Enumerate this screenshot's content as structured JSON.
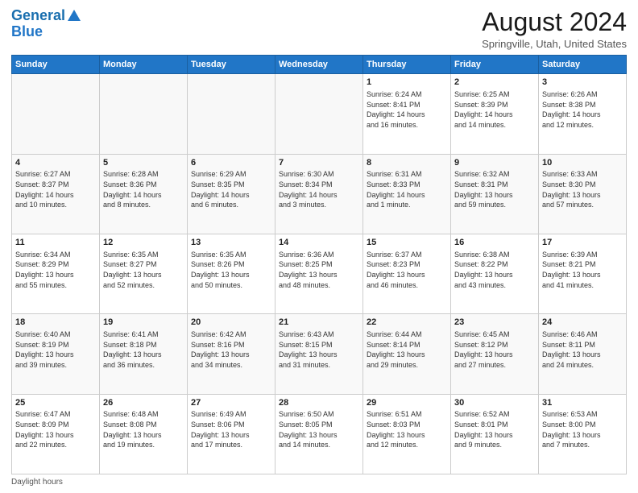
{
  "header": {
    "logo_line1": "General",
    "logo_line2": "Blue",
    "month_title": "August 2024",
    "location": "Springville, Utah, United States"
  },
  "days_of_week": [
    "Sunday",
    "Monday",
    "Tuesday",
    "Wednesday",
    "Thursday",
    "Friday",
    "Saturday"
  ],
  "weeks": [
    [
      {
        "day": "",
        "info": ""
      },
      {
        "day": "",
        "info": ""
      },
      {
        "day": "",
        "info": ""
      },
      {
        "day": "",
        "info": ""
      },
      {
        "day": "1",
        "info": "Sunrise: 6:24 AM\nSunset: 8:41 PM\nDaylight: 14 hours\nand 16 minutes."
      },
      {
        "day": "2",
        "info": "Sunrise: 6:25 AM\nSunset: 8:39 PM\nDaylight: 14 hours\nand 14 minutes."
      },
      {
        "day": "3",
        "info": "Sunrise: 6:26 AM\nSunset: 8:38 PM\nDaylight: 14 hours\nand 12 minutes."
      }
    ],
    [
      {
        "day": "4",
        "info": "Sunrise: 6:27 AM\nSunset: 8:37 PM\nDaylight: 14 hours\nand 10 minutes."
      },
      {
        "day": "5",
        "info": "Sunrise: 6:28 AM\nSunset: 8:36 PM\nDaylight: 14 hours\nand 8 minutes."
      },
      {
        "day": "6",
        "info": "Sunrise: 6:29 AM\nSunset: 8:35 PM\nDaylight: 14 hours\nand 6 minutes."
      },
      {
        "day": "7",
        "info": "Sunrise: 6:30 AM\nSunset: 8:34 PM\nDaylight: 14 hours\nand 3 minutes."
      },
      {
        "day": "8",
        "info": "Sunrise: 6:31 AM\nSunset: 8:33 PM\nDaylight: 14 hours\nand 1 minute."
      },
      {
        "day": "9",
        "info": "Sunrise: 6:32 AM\nSunset: 8:31 PM\nDaylight: 13 hours\nand 59 minutes."
      },
      {
        "day": "10",
        "info": "Sunrise: 6:33 AM\nSunset: 8:30 PM\nDaylight: 13 hours\nand 57 minutes."
      }
    ],
    [
      {
        "day": "11",
        "info": "Sunrise: 6:34 AM\nSunset: 8:29 PM\nDaylight: 13 hours\nand 55 minutes."
      },
      {
        "day": "12",
        "info": "Sunrise: 6:35 AM\nSunset: 8:27 PM\nDaylight: 13 hours\nand 52 minutes."
      },
      {
        "day": "13",
        "info": "Sunrise: 6:35 AM\nSunset: 8:26 PM\nDaylight: 13 hours\nand 50 minutes."
      },
      {
        "day": "14",
        "info": "Sunrise: 6:36 AM\nSunset: 8:25 PM\nDaylight: 13 hours\nand 48 minutes."
      },
      {
        "day": "15",
        "info": "Sunrise: 6:37 AM\nSunset: 8:23 PM\nDaylight: 13 hours\nand 46 minutes."
      },
      {
        "day": "16",
        "info": "Sunrise: 6:38 AM\nSunset: 8:22 PM\nDaylight: 13 hours\nand 43 minutes."
      },
      {
        "day": "17",
        "info": "Sunrise: 6:39 AM\nSunset: 8:21 PM\nDaylight: 13 hours\nand 41 minutes."
      }
    ],
    [
      {
        "day": "18",
        "info": "Sunrise: 6:40 AM\nSunset: 8:19 PM\nDaylight: 13 hours\nand 39 minutes."
      },
      {
        "day": "19",
        "info": "Sunrise: 6:41 AM\nSunset: 8:18 PM\nDaylight: 13 hours\nand 36 minutes."
      },
      {
        "day": "20",
        "info": "Sunrise: 6:42 AM\nSunset: 8:16 PM\nDaylight: 13 hours\nand 34 minutes."
      },
      {
        "day": "21",
        "info": "Sunrise: 6:43 AM\nSunset: 8:15 PM\nDaylight: 13 hours\nand 31 minutes."
      },
      {
        "day": "22",
        "info": "Sunrise: 6:44 AM\nSunset: 8:14 PM\nDaylight: 13 hours\nand 29 minutes."
      },
      {
        "day": "23",
        "info": "Sunrise: 6:45 AM\nSunset: 8:12 PM\nDaylight: 13 hours\nand 27 minutes."
      },
      {
        "day": "24",
        "info": "Sunrise: 6:46 AM\nSunset: 8:11 PM\nDaylight: 13 hours\nand 24 minutes."
      }
    ],
    [
      {
        "day": "25",
        "info": "Sunrise: 6:47 AM\nSunset: 8:09 PM\nDaylight: 13 hours\nand 22 minutes."
      },
      {
        "day": "26",
        "info": "Sunrise: 6:48 AM\nSunset: 8:08 PM\nDaylight: 13 hours\nand 19 minutes."
      },
      {
        "day": "27",
        "info": "Sunrise: 6:49 AM\nSunset: 8:06 PM\nDaylight: 13 hours\nand 17 minutes."
      },
      {
        "day": "28",
        "info": "Sunrise: 6:50 AM\nSunset: 8:05 PM\nDaylight: 13 hours\nand 14 minutes."
      },
      {
        "day": "29",
        "info": "Sunrise: 6:51 AM\nSunset: 8:03 PM\nDaylight: 13 hours\nand 12 minutes."
      },
      {
        "day": "30",
        "info": "Sunrise: 6:52 AM\nSunset: 8:01 PM\nDaylight: 13 hours\nand 9 minutes."
      },
      {
        "day": "31",
        "info": "Sunrise: 6:53 AM\nSunset: 8:00 PM\nDaylight: 13 hours\nand 7 minutes."
      }
    ]
  ],
  "footer": {
    "text": "Daylight hours"
  }
}
